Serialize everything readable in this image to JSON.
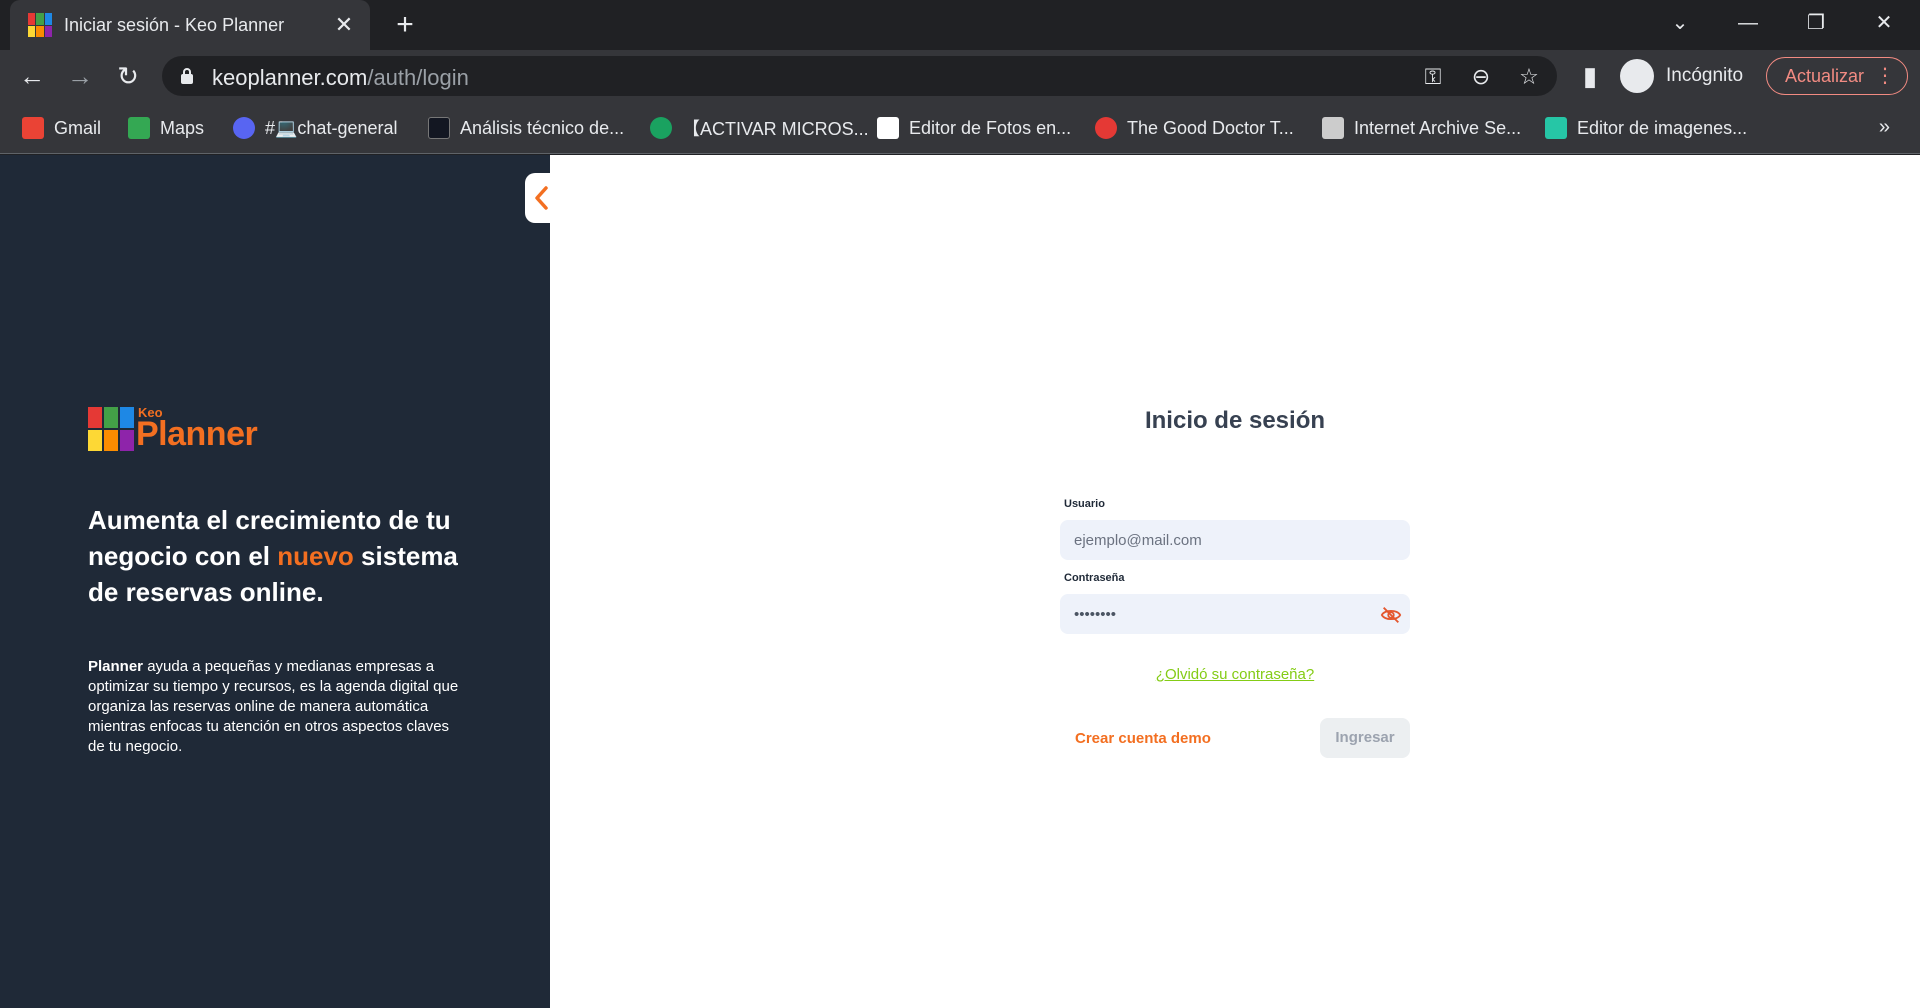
{
  "browser": {
    "tab_title": "Iniciar sesión - Keo Planner",
    "url_host": "keoplanner.com",
    "url_path": "/auth/login",
    "incognito_label": "Incógnito",
    "update_label": "Actualizar",
    "bookmarks": [
      {
        "label": "Gmail",
        "color": "#ea4335"
      },
      {
        "label": "Maps",
        "color": "#34a853"
      },
      {
        "label": "#💻chat-general",
        "color": "#5865f2"
      },
      {
        "label": "Análisis técnico de...",
        "color": "#131722"
      },
      {
        "label": "【ACTIVAR MICROS...",
        "color": "#1aa260"
      },
      {
        "label": "Editor de Fotos en...",
        "color": "#ffffff"
      },
      {
        "label": "The Good Doctor T...",
        "color": "#e53935"
      },
      {
        "label": "Internet Archive Se...",
        "color": "#cccccc"
      },
      {
        "label": "Editor de imagenes...",
        "color": "#26c6a6"
      }
    ]
  },
  "sidebar": {
    "logo_small": "Keo",
    "logo_big": "Planner",
    "hero_part1": "Aumenta el crecimiento de tu negocio con el ",
    "hero_accent": "nuevo",
    "hero_part2": " sistema de reservas online.",
    "desc_bold": "Planner",
    "desc_text": " ayuda a pequeñas y medianas empresas a optimizar su tiempo y recursos, es la agenda digital que organiza las reservas online de manera automática mientras enfocas tu atención en otros aspectos claves de tu negocio."
  },
  "login": {
    "title": "Inicio de sesión",
    "user_label": "Usuario",
    "user_placeholder": "ejemplo@mail.com",
    "password_label": "Contraseña",
    "password_value": "secret12",
    "forgot_label": "¿Olvidó su contraseña?",
    "demo_label": "Crear cuenta demo",
    "submit_label": "Ingresar"
  },
  "colors": {
    "sidebar_bg": "#1f2937",
    "accent": "#f36f21",
    "link_green": "#84cc16"
  }
}
